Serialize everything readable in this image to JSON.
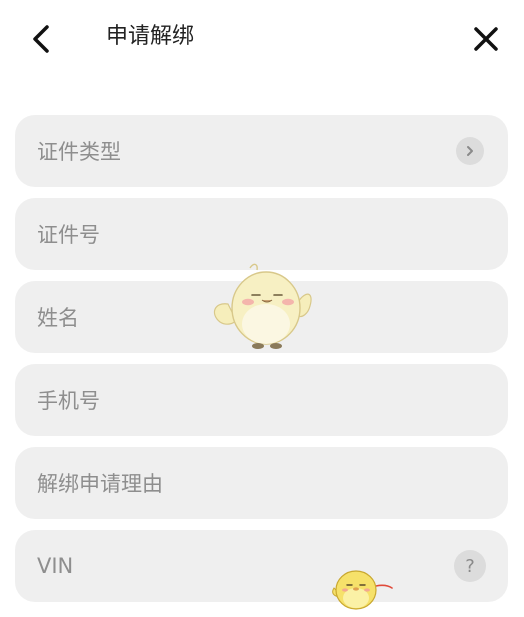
{
  "header": {
    "title": "申请解绑"
  },
  "form": {
    "fields": [
      {
        "label": "证件类型"
      },
      {
        "label": "证件号"
      },
      {
        "label": "姓名"
      },
      {
        "label": "手机号"
      },
      {
        "label": "解绑申请理由"
      },
      {
        "label": "VIN"
      }
    ],
    "help_symbol": "?"
  },
  "icons": {
    "back": "chevron-left-icon",
    "close": "close-icon",
    "select": "chevron-right-icon",
    "help": "question-mark-icon"
  },
  "colors": {
    "field_bg": "#efefef",
    "label": "#8e8e8e",
    "title": "#222222",
    "icon_circle": "#dcdcdc"
  }
}
